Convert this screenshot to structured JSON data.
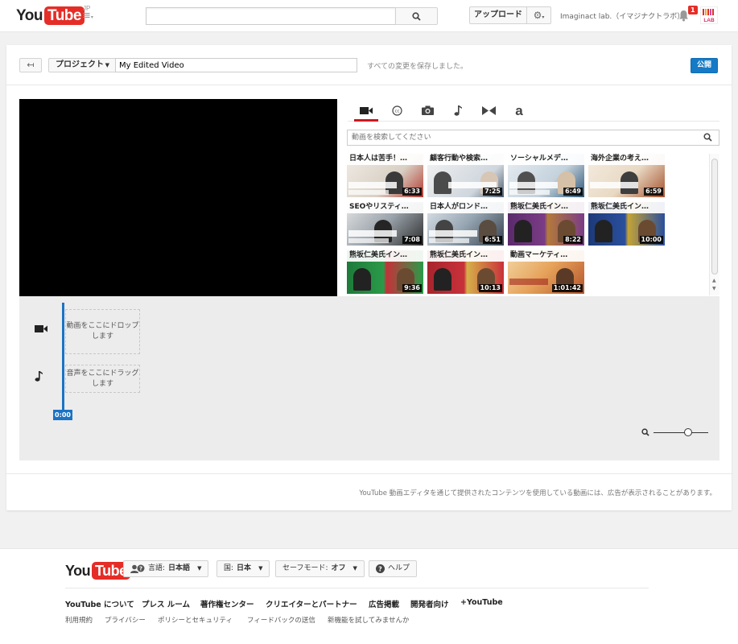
{
  "masthead": {
    "logo_you": "You",
    "logo_tube": "Tube",
    "logo_region": "JP",
    "search_value": "",
    "upload_label": "アップロード",
    "user_name": "Imaginact lab.（イマジナクトラボ）",
    "notification_count": "1",
    "avatar_text": "LAB"
  },
  "editor": {
    "project_label": "プロジェクト",
    "title_value": "My Edited Video",
    "save_status": "すべての変更を保存しました。",
    "publish_label": "公開",
    "media_search_placeholder": "動画を検索してください",
    "thumbnails": [
      {
        "title": "日本人は苦手！…",
        "duration": "6:33"
      },
      {
        "title": "顧客行動や検索…",
        "duration": "7:25"
      },
      {
        "title": "ソーシャルメデ…",
        "duration": "6:49"
      },
      {
        "title": "海外企業の考え…",
        "duration": "6:59"
      },
      {
        "title": "SEOやリスティ…",
        "duration": "7:08"
      },
      {
        "title": "日本人がロンド…",
        "duration": "6:51"
      },
      {
        "title": "熊坂仁美氏イン…",
        "duration": "8:22"
      },
      {
        "title": "熊坂仁美氏イン…",
        "duration": "10:00"
      },
      {
        "title": "熊坂仁美氏イン…",
        "duration": "9:36"
      },
      {
        "title": "熊坂仁美氏イン…",
        "duration": "10:13"
      },
      {
        "title": "動画マーケティ…",
        "duration": "1:01:42"
      }
    ],
    "video_drop_text": "動画をここにドロップします",
    "audio_drop_text": "音声をここにドラッグします",
    "playhead_time": "0:00",
    "ad_notice": "YouTube 動画エディタを通じて提供されたコンテンツを使用している動画には、広告が表示されることがあります。"
  },
  "footer": {
    "language_label": "言語:",
    "language_value": "日本語",
    "country_label": "国:",
    "country_value": "日本",
    "safety_label": "セーフモード:",
    "safety_value": "オフ",
    "help_label": "ヘルプ",
    "primary_links": [
      "YouTube について",
      "プレス ルーム",
      "著作権センター",
      "クリエイターとパートナー",
      "広告掲載",
      "開発者向け",
      "+YouTube"
    ],
    "secondary_links": [
      "利用規約",
      "プライバシー",
      "ポリシーとセキュリティ",
      "フィードバックの送信",
      "新機能を試してみませんか"
    ]
  },
  "colors": {
    "brand_red": "#e52d27",
    "accent_blue": "#167ac6",
    "playhead_blue": "#1b73c4"
  }
}
